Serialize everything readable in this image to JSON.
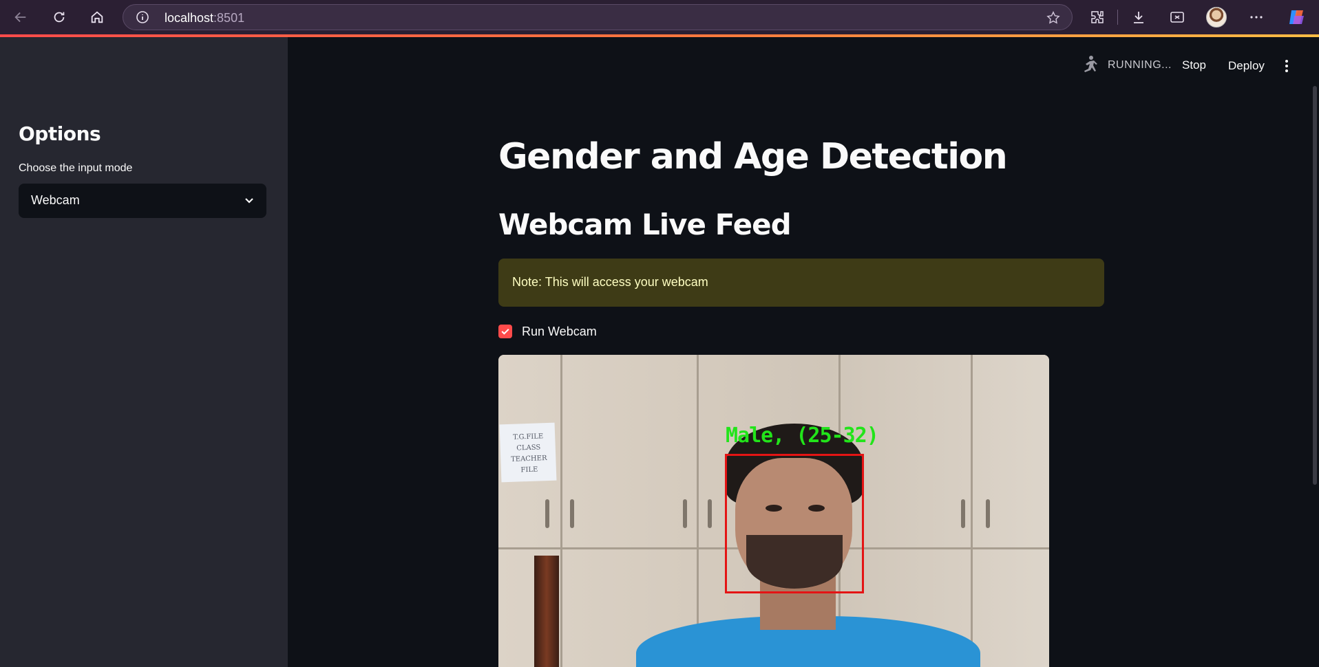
{
  "browser": {
    "url_host": "localhost",
    "url_port": ":8501"
  },
  "sidebar": {
    "title": "Options",
    "select_label": "Choose the input mode",
    "select_value": "Webcam"
  },
  "toolbar": {
    "status_text": "RUNNING...",
    "stop_label": "Stop",
    "deploy_label": "Deploy"
  },
  "main": {
    "title": "Gender and Age Detection",
    "subtitle": "Webcam Live Feed",
    "note": "Note: This will access your webcam",
    "checkbox_label": "Run Webcam",
    "checkbox_checked": true
  },
  "webcam": {
    "detection_label": "Male, (25-32)",
    "paper_text": "T.G.FILE CLASS TEACHER FILE"
  },
  "colors": {
    "accent": "#ff4b4b",
    "note_bg": "#3e3b16",
    "detection_box": "#e41414",
    "detection_text": "#22e41a"
  }
}
